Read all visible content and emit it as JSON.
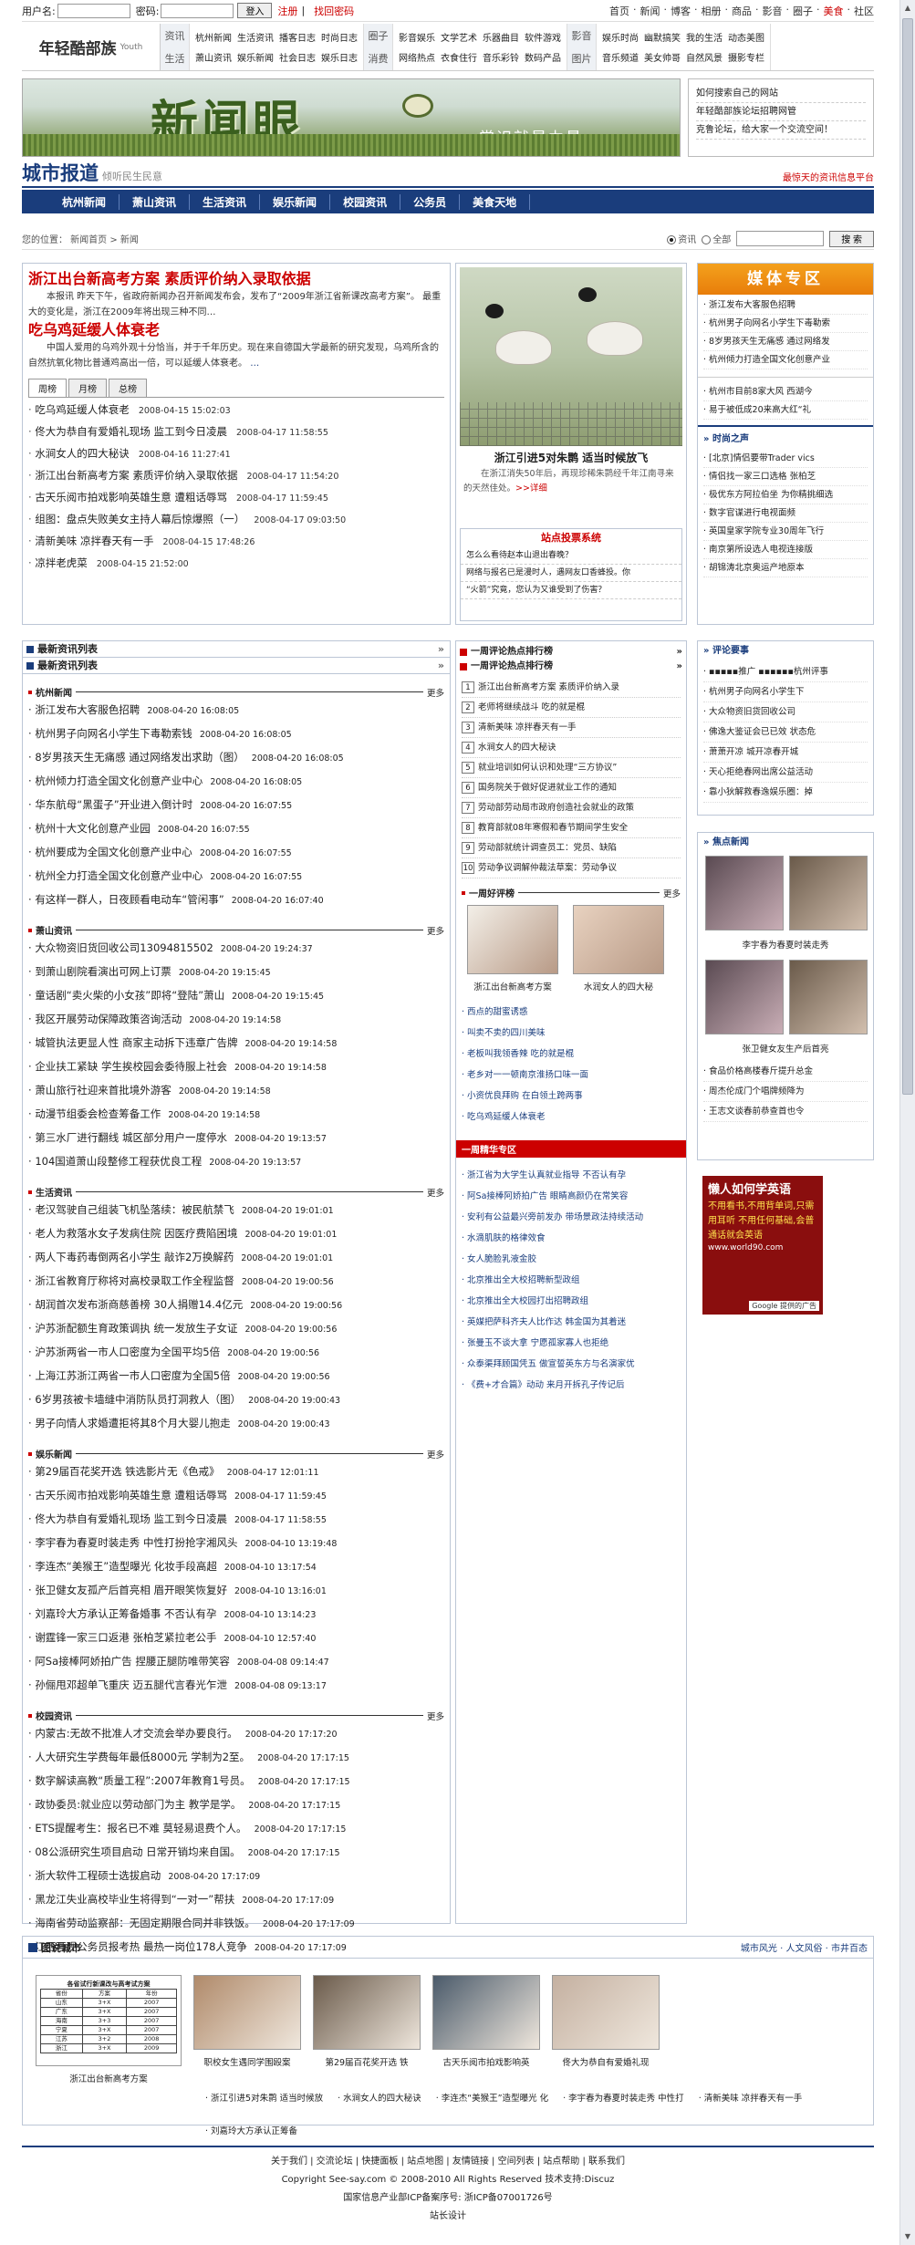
{
  "login": {
    "user_label": "用户名:",
    "pass_label": "密码:",
    "login_btn": "登入",
    "register": "注册",
    "forgot": "找回密码"
  },
  "toplinks": [
    "首页",
    "·",
    "新闻",
    "·",
    "博客",
    "·",
    "相册",
    "·",
    "商品",
    "·",
    "影音",
    "·",
    "圈子",
    "·",
    "美食",
    "·",
    "社区"
  ],
  "header": {
    "logo_title": "年轻酷部族",
    "logo_sub": "Youth"
  },
  "navgroups": [
    {
      "cat": [
        "资讯",
        "生活"
      ],
      "items": [
        "杭州新闻",
        "萧山资讯",
        "生活资讯",
        "娱乐新闻",
        "播客日志",
        "社会日志",
        "时尚日志",
        "娱乐日志"
      ]
    },
    {
      "cat": [
        "圈子",
        "消费"
      ],
      "items": [
        "影音娱乐",
        "网络热点",
        "文学艺术",
        "衣食住行",
        "乐器曲目",
        "音乐彩铃",
        "软件游戏",
        "数码产品"
      ]
    },
    {
      "cat": [
        "影音",
        "图片"
      ],
      "items": [
        "娱乐时尚",
        "音乐频道",
        "幽默搞笑",
        "美女帅哥",
        "我的生活",
        "自然风景",
        "动态美图",
        "摄影专栏"
      ]
    }
  ],
  "banner": {
    "title": "新闻眼",
    "subtitle": "常识就是力量",
    "links": [
      "如何搜索自己的网站",
      "年轻酷部族论坛招聘网管",
      "克鲁论坛，给大家一个交流空间！"
    ]
  },
  "city": {
    "title": "城市报道",
    "subtitle": "倾听民生民意",
    "right": "最惊天的资讯信息平台"
  },
  "mainnav": [
    "杭州新闻",
    "萧山资讯",
    "生活资讯",
    "娱乐新闻",
    "校园资讯",
    "公务员",
    "美食天地"
  ],
  "search": {
    "location": "您的位置： 新闻首页 > 新闻",
    "opt1": "资讯",
    "opt2": "全部",
    "btn": "搜 索"
  },
  "lead": {
    "h1": "浙江出台新高考方案  素质评价纳入录取依据",
    "p1": "本报讯  昨天下午，省政府新闻办召开新闻发布会，发布了“2009年浙江省新课改高考方案”。  最重大的变化是，浙江在2009年将出现三种不同…",
    "h2": "吃乌鸡延缓人体衰老",
    "p2": "中国人爱用的乌鸡外观十分恰当，并于千年历史。现在来自德国大学最新的研究发现，乌鸡所含的自然抗氧化物比普通鸡高出一倍，可以延缓人体衰老。",
    "more": "…",
    "tabs": [
      "周榜",
      "月榜",
      "总榜"
    ]
  },
  "leadlist": [
    {
      "t": "吃乌鸡延缓人体衰老",
      "d": "2008-04-15 15:02:03"
    },
    {
      "t": "佟大为恭自有爱婚礼现场  监工到今日凌晨",
      "d": "2008-04-17 11:58:55"
    },
    {
      "t": "水涧女人的四大秘诀",
      "d": "2008-04-16 11:27:41"
    },
    {
      "t": "浙江出台新高考方案  素质评价纳入录取依据",
      "d": "2008-04-17 11:54:20"
    },
    {
      "t": "古天乐阅市拍戏影响英雄生意  遭粗话辱骂",
      "d": "2008-04-17 11:59:45"
    },
    {
      "t": "组图：盘点失败美女主持人幕后惊爆照（一）",
      "d": "2008-04-17 09:03:50"
    },
    {
      "t": "清新美味  凉拌春天有一手",
      "d": "2008-04-15 17:48:26"
    },
    {
      "t": "凉拌老虎菜",
      "d": "2008-04-15 21:52:00"
    }
  ],
  "photo": {
    "caption": "浙江引进5对朱鹮  适当时候放飞",
    "text": "在浙江消失50年后，再现珍稀朱鹮经千年江南寻来的天然佳处。",
    "more": ">>详细"
  },
  "vote": {
    "title": "站点投票系统",
    "items": [
      "怎么么看待赵本山退出春晚？",
      "网络与报名已是漫时人，遇网友口香蜂投。你",
      "“火箭”究竟，您认为又谁受到了伤害？"
    ]
  },
  "media": {
    "title": "媒体专区",
    "items": [
      "浙江发布大客服色招聘",
      "杭州男子向网名小学生下毒勒索",
      "8岁男孩天生无痛感  通过网络发",
      "杭州倾力打造全国文化创意产业"
    ],
    "items2": [
      "杭州市目前8家大风 西湖今",
      "易于被低成20来高大红“礼"
    ]
  },
  "hotpoint": {
    "title": "时尚之声",
    "items": [
      "[北京]情侣要带Trader vics",
      "情侣找一家三口选格  张柏芝",
      "极优东方阿拉伯坐  为你精挑细选",
      "数字官谋进行电视面频",
      "英国皇家学院专业30周年飞行",
      "南京第所设选人电视连接版",
      "胡锦涛北京奥运产地原本"
    ]
  },
  "col1": {
    "tabs": [
      "最新资讯列表",
      "最新资讯列表"
    ],
    "groups": [
      {
        "name": "杭州新闻",
        "more": "更多",
        "items": [
          {
            "t": "浙江发布大客服色招聘",
            "d": "2008-04-20 16:08:05"
          },
          {
            "t": "杭州男子向网名小学生下毒勒索钱",
            "d": "2008-04-20 16:08:05"
          },
          {
            "t": "8岁男孩天生无痛感  通过网络发出求助（图）",
            "d": "2008-04-20 16:08:05"
          },
          {
            "t": "杭州倾力打造全国文化创意产业中心",
            "d": "2008-04-20 16:08:05"
          },
          {
            "t": "华东航母“黑蛋子”开业进入倒计时",
            "d": "2008-04-20 16:07:55"
          },
          {
            "t": "杭州十大文化创意产业园",
            "d": "2008-04-20 16:07:55"
          },
          {
            "t": "杭州要成为全国文化创意产业中心",
            "d": "2008-04-20 16:07:55"
          },
          {
            "t": "杭州全力打造全国文化创意产业中心",
            "d": "2008-04-20 16:07:55"
          },
          {
            "t": "有这样一群人，日夜顾看电动车“管闲事”",
            "d": "2008-04-20 16:07:40"
          }
        ]
      },
      {
        "name": "萧山资讯",
        "more": "更多",
        "items": [
          {
            "t": "大众物资旧货回收公司13094815502",
            "d": "2008-04-20 19:24:37"
          },
          {
            "t": "到萧山剧院看演出可网上订票",
            "d": "2008-04-20 19:15:45"
          },
          {
            "t": "童话剧“卖火柴的小女孩”即将“登陆”萧山",
            "d": "2008-04-20 19:15:45"
          },
          {
            "t": "我区开展劳动保障政策咨询活动",
            "d": "2008-04-20 19:14:58"
          },
          {
            "t": "城管执法更显人性  商家主动拆下违章广告牌",
            "d": "2008-04-20 19:14:58"
          },
          {
            "t": "企业扶工紧缺  学生挨校园会委待服上社会",
            "d": "2008-04-20 19:14:58"
          },
          {
            "t": "萧山旅行社迎来首批境外游客",
            "d": "2008-04-20 19:14:58"
          },
          {
            "t": "动漫节组委会检查筹备工作",
            "d": "2008-04-20 19:14:58"
          },
          {
            "t": "第三水厂进行翻线  城区部分用户一度停水",
            "d": "2008-04-20 19:13:57"
          },
          {
            "t": "104国道萧山段整修工程获优良工程",
            "d": "2008-04-20 19:13:57"
          }
        ]
      },
      {
        "name": "生活资讯",
        "more": "更多",
        "items": [
          {
            "t": "老汉驾驶自己组装飞机坠落续：被民航禁飞",
            "d": "2008-04-20 19:01:01"
          },
          {
            "t": "老人为救落水女子发病住院  因医疗费陷困境",
            "d": "2008-04-20 19:01:01"
          },
          {
            "t": "两人下毒药毒倒两名小学生  敲诈2万换解药",
            "d": "2008-04-20 19:01:01"
          },
          {
            "t": "浙江省教育厅称将对高校录取工作全程监督",
            "d": "2008-04-20 19:00:56"
          },
          {
            "t": "胡润首次发布浙商慈善榜  30人捐赠14.4亿元",
            "d": "2008-04-20 19:00:56"
          },
          {
            "t": "沪苏浙配额生育政策调执  统一发放生子女证",
            "d": "2008-04-20 19:00:56"
          },
          {
            "t": "沪苏浙两省一市人口密度为全国平均5倍",
            "d": "2008-04-20 19:00:56"
          },
          {
            "t": "上海江苏浙江两省一市人口密度为全国5倍",
            "d": "2008-04-20 19:00:56"
          },
          {
            "t": "6岁男孩被卡墙缝中消防队员打洞救人（图）",
            "d": "2008-04-20 19:00:43"
          },
          {
            "t": "男子向情人求婚遭拒将其8个月大婴儿抱走",
            "d": "2008-04-20 19:00:43"
          }
        ]
      },
      {
        "name": "娱乐新闻",
        "more": "更多",
        "items": [
          {
            "t": "第29届百花奖开选  铁选影片无《色戒》",
            "d": "2008-04-17 12:01:11"
          },
          {
            "t": "古天乐阅市拍戏影响英雄生意  遭粗话辱骂",
            "d": "2008-04-17 11:59:45"
          },
          {
            "t": "佟大为恭自有爱婚礼现场  监工到今日凌晨",
            "d": "2008-04-17 11:58:55"
          },
          {
            "t": "李宇春为春夏时装走秀  中性打扮抢字湘风头",
            "d": "2008-04-10 13:19:48"
          },
          {
            "t": "李连杰“美猴王”造型曝光  化妆手段高超",
            "d": "2008-04-10 13:17:54"
          },
          {
            "t": "张卫健女友孤产后首亮相  眉开眼笑恢复好",
            "d": "2008-04-10 13:16:01"
          },
          {
            "t": "刘嘉玲大方承认正筹备婚事  不否认有孕",
            "d": "2008-04-10 13:14:23"
          },
          {
            "t": "谢霆锋一家三口返港  张柏芝紧拉老公手",
            "d": "2008-04-10 12:57:40"
          },
          {
            "t": "阿Sa接棒阿娇拍广告  捏腰正腿防唯带笑容",
            "d": "2008-04-08 09:14:47"
          },
          {
            "t": "孙俪甩邓超单飞重庆  迈五腿代言春光乍泄",
            "d": "2008-04-08 09:13:17"
          }
        ]
      },
      {
        "name": "校园资讯",
        "more": "更多",
        "items": [
          {
            "t": "内蒙古:无故不批准人才交流会举办要良行。",
            "d": "2008-04-20 17:17:20"
          },
          {
            "t": "人大研究生学费每年最低8000元  学制为2至。",
            "d": "2008-04-20 17:17:15"
          },
          {
            "t": "数字解读高教“质量工程”:2007年教育1号员。",
            "d": "2008-04-20 17:17:15"
          },
          {
            "t": "政协委员:就业应以劳动部门为主  教学是学。",
            "d": "2008-04-20 17:17:15"
          },
          {
            "t": "ETS提醒考生：报名已不难  莫轻易退费个人。",
            "d": "2008-04-20 17:17:15"
          },
          {
            "t": "08公派研究生项目启动  日常开销均来自国。",
            "d": "2008-04-20 17:17:15"
          },
          {
            "t": "浙大软件工程硕士选拔启动",
            "d": "2008-04-20 17:17:09"
          },
          {
            "t": "黑龙江失业高校毕业生将得到“一对一”帮扶",
            "d": "2008-04-20 17:17:09"
          },
          {
            "t": "海南省劳动监察部：无固定期限合同并非铁饭。",
            "d": "2008-04-20 17:17:09"
          },
          {
            "t": "江西再现公务员报考热  最热一岗位178人竞争",
            "d": "2008-04-20 17:17:09"
          }
        ]
      }
    ]
  },
  "col2": {
    "h1": "一周评论热点排行榜",
    "h2": "一周评论热点排行榜",
    "rank": [
      "浙江出台新高考方案  素质评价纳入录",
      "老师将继续战斗  吃的就是棍",
      "清新美味  凉拌春天有一手",
      "水涧女人的四大秘诀",
      "就业培训如何认识和处理“三方协议”",
      "国务院关于做好促进就业工作的通知",
      "劳动部劳动局市政府创造社会就业的政策",
      "教育部就08年寒假和春节期间学生安全",
      "劳动部就统计调查员工：党员、缺陷",
      "劳动争议调解仲裁法草案：劳动争议"
    ],
    "h3": "一周好评榜",
    "more": "更多",
    "pics": [
      {
        "c": "浙江出台新高考方案"
      },
      {
        "c": "水润女人的四大秘"
      }
    ],
    "list": [
      "西点的甜蜜诱惑",
      "叫卖不卖的四川美味",
      "老板叫我领香辣  吃的就是棍",
      "老乡对一一顿南京淮扬口味一面",
      "小资优良拜购  在白领土跨两事",
      "吃乌鸡延缓人体衰老"
    ],
    "red": "一周精华专区",
    "list2": [
      "浙江省为大学生认真就业指导 不否认有孕",
      "阿Sa接棒阿娇拍广告  眼睛高颜仍在常笑容",
      "安利有公益最兴旁前发办  带场景政法持续活动",
      "水滴肌肤的格律效食",
      "女人脆脸乳液金胶",
      "北京推出全大校招聘新型政组",
      "北京推出全大校园打出招聘政组",
      "英媒把萨科齐夫人比作达  韩金国为其着迷",
      "张曼玉不谈大拿  宁愿孤家寡人也拒绝",
      "众泰渠拜顾国凭五  做宣誓英东方与名演家优",
      "《费+才合篇》动动  来月开拆孔子传记后"
    ]
  },
  "col3": {
    "h1": "评论要事",
    "list1": [
      "▪▪▪▪▪推广 ▪▪▪▪▪▪杭州评事",
      "杭州男子向网名小学生下",
      "大众物资旧货回收公司",
      "佛逸大鉴证会已已效  状态危",
      "萧萧开凉  城开凉春开城",
      "天心拒绝春网出席公益活动",
      "靠小狄解救春逸娱乐圈：掉"
    ],
    "h2": "焦点新闻",
    "pics": [
      {
        "c": "李宇春为春夏时装走秀"
      },
      {
        "c": "张卫健女友生产后首亮"
      }
    ],
    "list2": [
      "食品价格高楼春斤提升总金",
      "周杰伦成门个唱牌频降为",
      "王志文谈春前恭查首也令"
    ],
    "ad": {
      "title": "懒人如何学英语",
      "body": "不用看书,不用背单词,只需用耳听  不用任何基础,会普通话就会英语",
      "url": "www.world90.com",
      "tag": "Google 提供的广告"
    }
  },
  "gallery": {
    "title": "图说城市",
    "right": "城市风光 · 人文风俗 · 市井百态",
    "table": {
      "title": "各省试行新课改与高考试方案",
      "rows": [
        [
          "省份",
          "方案",
          "年份"
        ],
        [
          "山东",
          "3+X",
          "2007"
        ],
        [
          "广东",
          "3+X",
          "2007"
        ],
        [
          "海南",
          "3+3",
          "2007"
        ],
        [
          "宁夏",
          "3+X",
          "2007"
        ],
        [
          "江苏",
          "3+2",
          "2008"
        ],
        [
          "浙江",
          "3+X",
          "2009"
        ]
      ]
    },
    "items": [
      {
        "c": "浙江出台新高考方案"
      },
      {
        "c": "职校女生遇同学围殴案"
      },
      {
        "c": "第29届百花奖开选  铁"
      },
      {
        "c": "古天乐阅市拍戏影响英"
      },
      {
        "c": "佟大为恭自有爱婚礼现"
      }
    ],
    "bottom": [
      "浙江引进5对朱鹮  适当时候放",
      "水涧女人的四大秘诀",
      "李连杰“美猴王”造型曝光  化",
      "李宇春为春夏时装走秀  中性打",
      "清新美味  凉拌春天有一手",
      "刘嘉玲大方承认正筹备"
    ]
  },
  "footer": {
    "links": "关于我们 | 交流论坛 | 快捷面板 | 站点地图 | 友情链接 | 空间列表 | 站点帮助 | 联系我们",
    "copyright": "Copyright See-say.com © 2008-2010 All Rights Reserved 技术支持:Discuz",
    "icp": "国家信息产业部ICP备案序号: 浙ICP备07001726号",
    "design": "站长设计"
  }
}
